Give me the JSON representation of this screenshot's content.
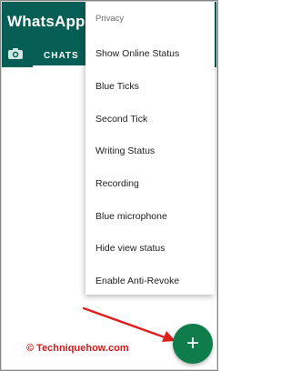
{
  "app": {
    "title": "WhatsApp",
    "tabs": [
      {
        "label": "",
        "icon": "camera-icon"
      },
      {
        "label": "CHATS"
      }
    ]
  },
  "menu": {
    "header": "Privacy",
    "items": [
      "Show Online Status",
      "Blue Ticks",
      "Second Tick",
      "Writing Status",
      "Recording",
      "Blue microphone",
      "Hide view status",
      "Enable Anti-Revoke"
    ]
  },
  "fab": {
    "label": "+",
    "icon": "plus-icon",
    "color": "#0f7d4b"
  },
  "watermark": {
    "text": "© Techniquehow.com",
    "color": "#d41c1c"
  },
  "colors": {
    "appbar": "#075e54",
    "arrow": "#e02020"
  }
}
